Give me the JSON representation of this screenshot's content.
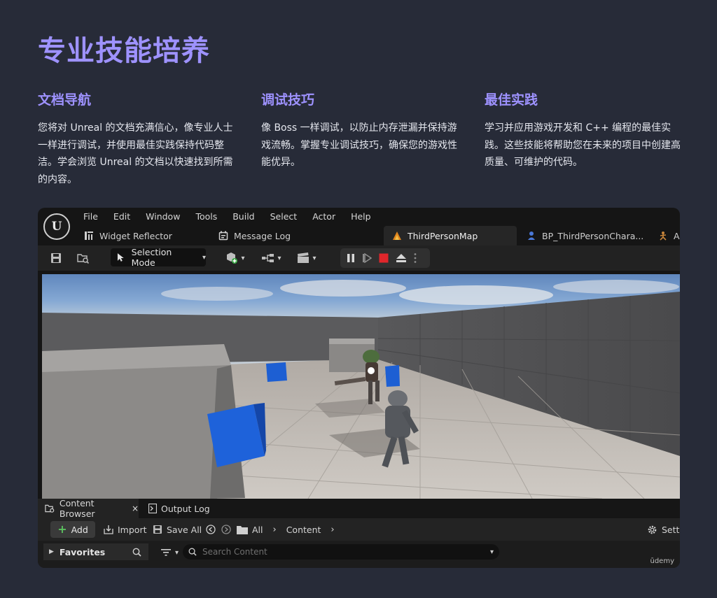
{
  "page": {
    "title": "专业技能培养"
  },
  "features": [
    {
      "title": "文档导航",
      "body": "您将对 Unreal 的文档充满信心，像专业人士一样进行调试，并使用最佳实践保持代码整洁。学会浏览 Unreal 的文档以快速找到所需的内容。"
    },
    {
      "title": "调试技巧",
      "body": "像 Boss 一样调试，以防止内存泄漏并保持游戏流畅。掌握专业调试技巧，确保您的游戏性能优异。"
    },
    {
      "title": "最佳实践",
      "body": "学习并应用游戏开发和 C++ 编程的最佳实践。这些技能将帮助您在未来的项目中创建高质量、可维护的代码。"
    }
  ],
  "editor": {
    "logo_text": "U",
    "menu": [
      "File",
      "Edit",
      "Window",
      "Tools",
      "Build",
      "Select",
      "Actor",
      "Help"
    ],
    "tabs": [
      "Widget Reflector",
      "Message Log",
      "ThirdPersonMap",
      "BP_ThirdPersonChara...",
      "ABP_Player"
    ],
    "selection_mode": "Selection Mode",
    "panel_tabs": [
      "Content Browser",
      "Output Log"
    ],
    "panel_close": "×",
    "content_browser": {
      "add": "Add",
      "import": "Import",
      "save_all": "Save All",
      "path_all": "All",
      "path_content": "Content",
      "settings": "Setti",
      "favorites": "Favorites",
      "search_placeholder": "Search Content"
    },
    "watermark": "ūdemy"
  },
  "colors": {
    "background": "#272b38",
    "accent": "#9e92ff",
    "stop_red": "#e0262b"
  }
}
